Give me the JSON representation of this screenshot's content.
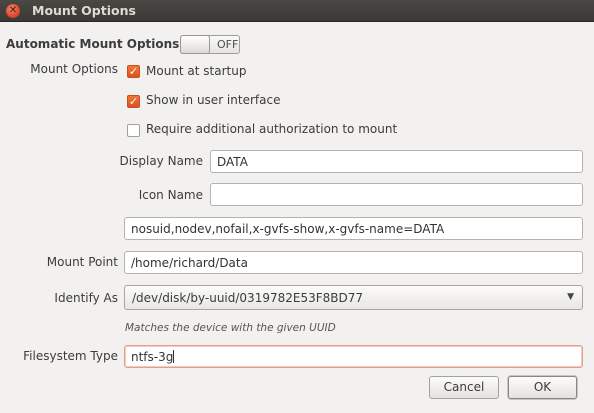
{
  "window": {
    "title": "Mount Options"
  },
  "automatic": {
    "label": "Automatic Mount Options",
    "toggle_state": "OFF"
  },
  "mount_options": {
    "label": "Mount Options",
    "checkboxes": [
      {
        "label": "Mount at startup",
        "checked": true
      },
      {
        "label": "Show in user interface",
        "checked": true
      },
      {
        "label": "Require additional authorization to mount",
        "checked": false
      }
    ]
  },
  "display_name": {
    "label": "Display Name",
    "value": "DATA"
  },
  "icon_name": {
    "label": "Icon Name",
    "value": ""
  },
  "options_string": {
    "value": "nosuid,nodev,nofail,x-gvfs-show,x-gvfs-name=DATA"
  },
  "mount_point": {
    "label": "Mount Point",
    "value": "/home/richard/Data"
  },
  "identify_as": {
    "label": "Identify As",
    "value": "/dev/disk/by-uuid/0319782E53F8BD77",
    "hint": "Matches the device with the given UUID"
  },
  "filesystem_type": {
    "label": "Filesystem Type",
    "value": "ntfs-3g"
  },
  "buttons": {
    "cancel": "Cancel",
    "ok": "OK"
  },
  "icons": {
    "close": "close-icon",
    "dropdown": "chevron-down-icon",
    "check": "checkmark-icon"
  },
  "colors": {
    "accent": "#dd5020",
    "titlebar": "#3c3b37"
  }
}
